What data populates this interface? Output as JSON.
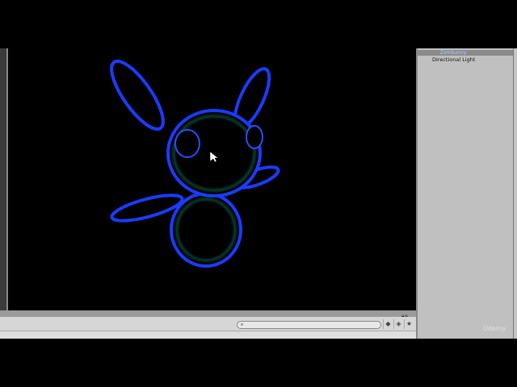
{
  "hierarchy": {
    "selected": "Zombunny",
    "items": [
      "Directional Light"
    ]
  },
  "project": {
    "search_placeholder": "",
    "search_icon": "magnifier-icon",
    "buttons": [
      "filter-by-type",
      "filter-by-label",
      "favorites"
    ]
  },
  "watermark": "Udemy",
  "colors": {
    "outline": "#1a3cff",
    "glow": "#20c080",
    "hierarchy_bg": "#c0c0c0"
  }
}
